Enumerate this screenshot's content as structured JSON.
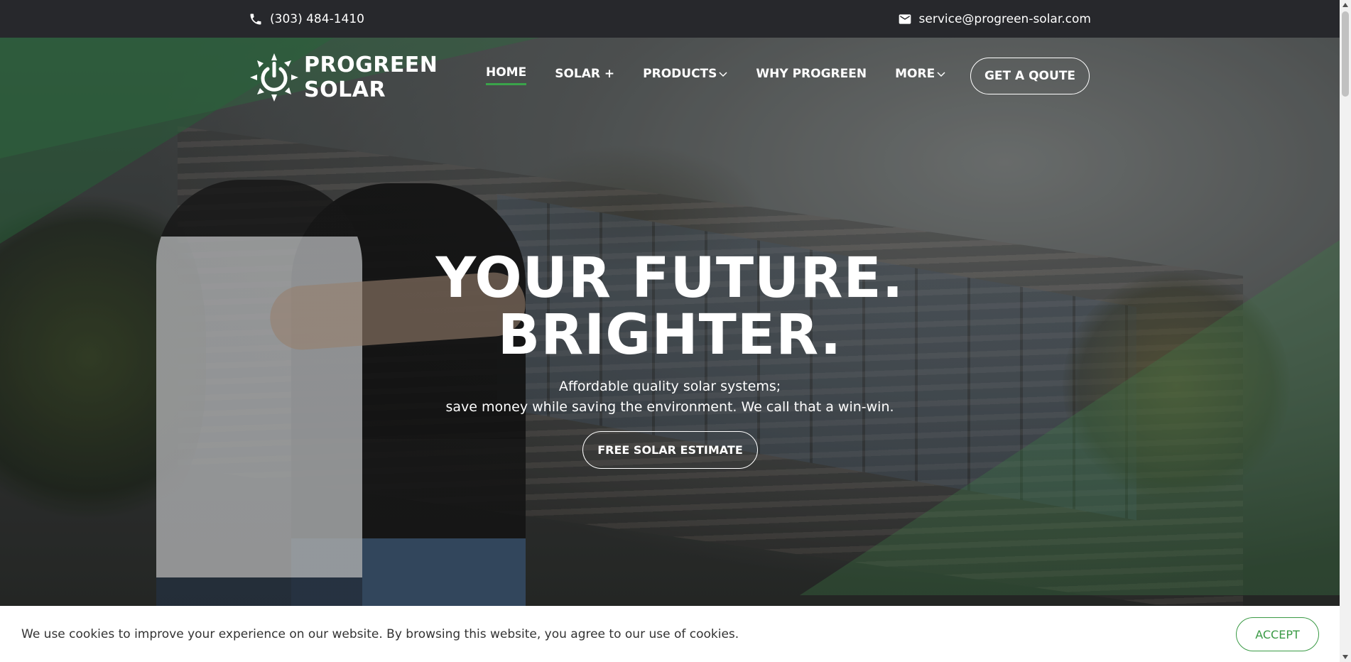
{
  "topbar": {
    "phone": "(303) 484-1410",
    "email": "service@progreen-solar.com",
    "phone_icon": "phone-icon",
    "email_icon": "envelope-icon"
  },
  "header": {
    "logo_line1": "PROGREEN",
    "logo_line2": "SOLAR",
    "logo_icon": "power-sun-icon",
    "nav": {
      "home": "HOME",
      "solar": "SOLAR +",
      "products": "PRODUCTS",
      "why": "WHY PROGREEN",
      "more": "MORE"
    },
    "active_nav": "HOME",
    "quote_button": "GET A QOUTE"
  },
  "hero": {
    "headline_line1": "YOUR FUTURE.",
    "headline_line2": "BRIGHTER.",
    "sub_line1": "Affordable quality solar systems;",
    "sub_line2": "save money while saving the environment. We call that a win-win.",
    "cta": "FREE SOLAR ESTIMATE"
  },
  "cookie": {
    "message": "We use cookies to improve your experience on our website. By browsing this website, you agree to our use of cookies.",
    "accept": "ACCEPT"
  },
  "colors": {
    "accent_green": "#3aa34a",
    "topbar_bg": "#27282c",
    "cookie_bg": "#ffffff"
  }
}
